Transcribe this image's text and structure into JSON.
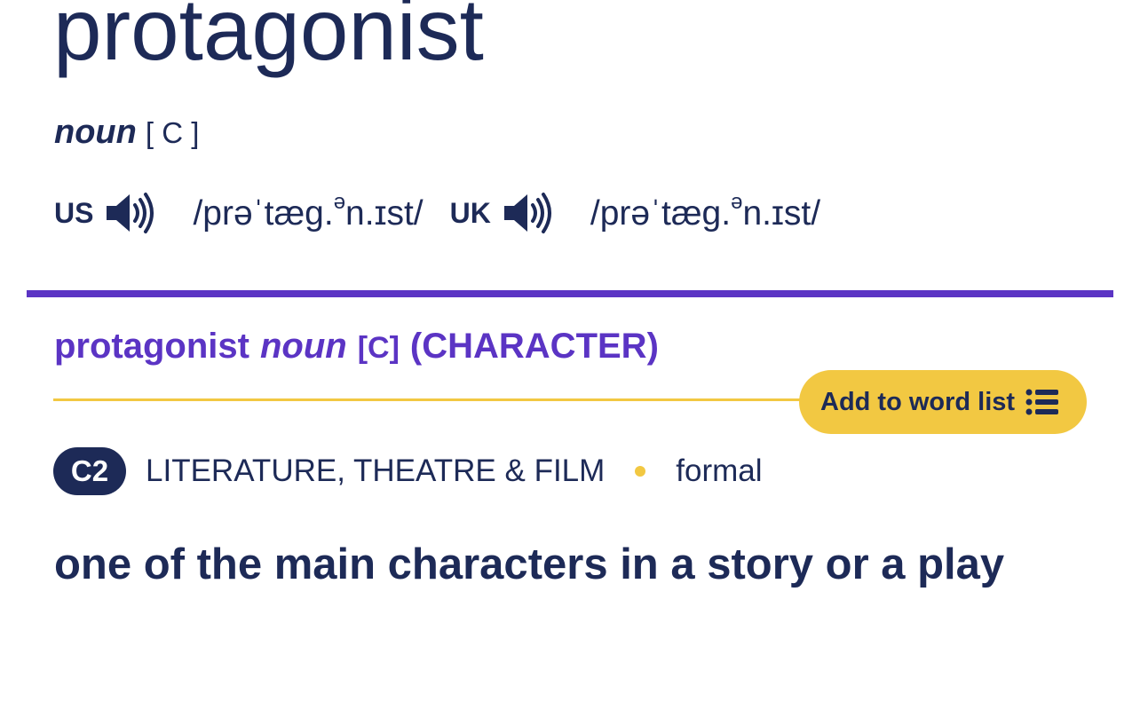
{
  "entry": {
    "headword": "protagonist",
    "part_of_speech": "noun",
    "grammar_code": "[ C ]",
    "pronunciations": [
      {
        "region": "US",
        "icon": "speaker-icon",
        "ipa_pre": "/prəˈtæg.",
        "ipa_sup": "ə",
        "ipa_post": "n.ɪst/"
      },
      {
        "region": "UK",
        "icon": "speaker-icon",
        "ipa_pre": "/prəˈtæg.",
        "ipa_sup": "ə",
        "ipa_post": "n.ɪst/"
      }
    ]
  },
  "sense": {
    "headword": "protagonist",
    "part_of_speech": "noun",
    "grammar_code": "[C]",
    "guideword": "(CHARACTER)",
    "add_to_word_list_label": "Add to word list",
    "add_to_word_list_icon": "list-icon",
    "level": "C2",
    "domain": "LITERATURE, THEATRE & FILM",
    "register": "formal",
    "definition": "one of the main characters in a story or a play"
  },
  "colors": {
    "text": "#1d2a57",
    "accent_purple": "#5b34c4",
    "accent_yellow": "#f2c842"
  }
}
